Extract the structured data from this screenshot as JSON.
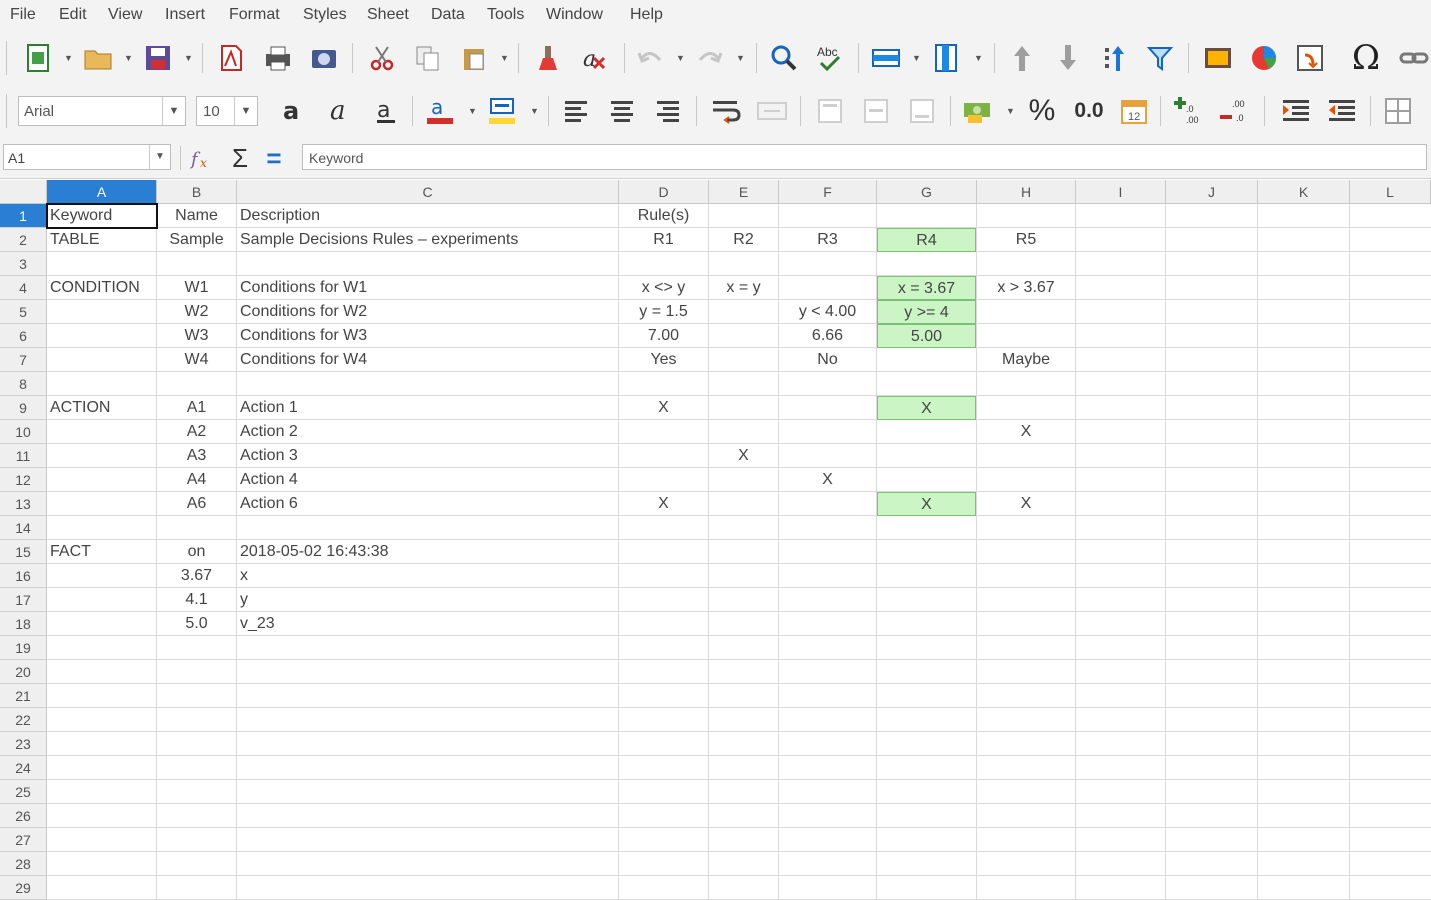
{
  "menu": [
    "File",
    "Edit",
    "View",
    "Insert",
    "Format",
    "Styles",
    "Sheet",
    "Data",
    "Tools",
    "Window",
    "Help"
  ],
  "toolbar": {
    "font_name": "Arial",
    "font_size": "10",
    "percent_label": "%",
    "decimal_label": "0.0",
    "omega_label": "Ω",
    "sum_label": "Σ",
    "equals_label": "="
  },
  "formula_bar": {
    "name_box": "A1",
    "content": "Keyword"
  },
  "columns": [
    "A",
    "B",
    "C",
    "D",
    "E",
    "F",
    "G",
    "H",
    "I",
    "J",
    "K",
    "L"
  ],
  "selected_column": "A",
  "selected_row": "1",
  "rows": [
    "1",
    "2",
    "3",
    "4",
    "5",
    "6",
    "7",
    "8",
    "9",
    "10",
    "11",
    "12",
    "13",
    "14",
    "15",
    "16",
    "17",
    "18",
    "19",
    "20",
    "21",
    "22",
    "23",
    "24",
    "25",
    "26",
    "27",
    "28",
    "29"
  ],
  "cells": [
    {
      "ref": "A1",
      "text": "Keyword"
    },
    {
      "ref": "B1",
      "text": "Name"
    },
    {
      "ref": "C1",
      "text": "Description"
    },
    {
      "ref": "D1",
      "text": "Rule(s)"
    },
    {
      "ref": "A2",
      "text": "TABLE"
    },
    {
      "ref": "B2",
      "text": "Sample"
    },
    {
      "ref": "C2",
      "text": "Sample Decisions Rules – experiments"
    },
    {
      "ref": "D2",
      "text": "R1"
    },
    {
      "ref": "E2",
      "text": "R2"
    },
    {
      "ref": "F2",
      "text": "R3"
    },
    {
      "ref": "G2",
      "text": "R4",
      "highlight": true
    },
    {
      "ref": "H2",
      "text": "R5"
    },
    {
      "ref": "A4",
      "text": "CONDITION"
    },
    {
      "ref": "B4",
      "text": "W1"
    },
    {
      "ref": "C4",
      "text": "Conditions for W1"
    },
    {
      "ref": "D4",
      "text": "x <> y"
    },
    {
      "ref": "E4",
      "text": "x = y"
    },
    {
      "ref": "G4",
      "text": "x = 3.67",
      "highlight": true
    },
    {
      "ref": "H4",
      "text": "x > 3.67"
    },
    {
      "ref": "B5",
      "text": "W2"
    },
    {
      "ref": "C5",
      "text": "Conditions for W2"
    },
    {
      "ref": "D5",
      "text": "y = 1.5"
    },
    {
      "ref": "F5",
      "text": "y < 4.00"
    },
    {
      "ref": "G5",
      "text": "y >= 4",
      "highlight": true
    },
    {
      "ref": "B6",
      "text": "W3"
    },
    {
      "ref": "C6",
      "text": "Conditions for W3"
    },
    {
      "ref": "D6",
      "text": "7.00"
    },
    {
      "ref": "F6",
      "text": "6.66"
    },
    {
      "ref": "G6",
      "text": "5.00",
      "highlight": true
    },
    {
      "ref": "B7",
      "text": "W4"
    },
    {
      "ref": "C7",
      "text": "Conditions for W4"
    },
    {
      "ref": "D7",
      "text": "Yes"
    },
    {
      "ref": "F7",
      "text": "No"
    },
    {
      "ref": "H7",
      "text": "Maybe"
    },
    {
      "ref": "A9",
      "text": "ACTION"
    },
    {
      "ref": "B9",
      "text": "A1"
    },
    {
      "ref": "C9",
      "text": "Action 1"
    },
    {
      "ref": "D9",
      "text": "X"
    },
    {
      "ref": "G9",
      "text": "X",
      "highlight": true
    },
    {
      "ref": "B10",
      "text": "A2"
    },
    {
      "ref": "C10",
      "text": "Action 2"
    },
    {
      "ref": "H10",
      "text": "X"
    },
    {
      "ref": "B11",
      "text": "A3"
    },
    {
      "ref": "C11",
      "text": "Action 3"
    },
    {
      "ref": "E11",
      "text": "X"
    },
    {
      "ref": "B12",
      "text": "A4"
    },
    {
      "ref": "C12",
      "text": "Action 4"
    },
    {
      "ref": "F12",
      "text": "X"
    },
    {
      "ref": "B13",
      "text": "A6"
    },
    {
      "ref": "C13",
      "text": "Action 6"
    },
    {
      "ref": "D13",
      "text": "X"
    },
    {
      "ref": "G13",
      "text": "X",
      "highlight": true
    },
    {
      "ref": "H13",
      "text": "X"
    },
    {
      "ref": "A15",
      "text": "FACT"
    },
    {
      "ref": "B15",
      "text": "on"
    },
    {
      "ref": "C15",
      "text": "2018-05-02 16:43:38"
    },
    {
      "ref": "B16",
      "text": "3.67"
    },
    {
      "ref": "C16",
      "text": "x"
    },
    {
      "ref": "B17",
      "text": "4.1"
    },
    {
      "ref": "C17",
      "text": "y"
    },
    {
      "ref": "B18",
      "text": "5.0"
    },
    {
      "ref": "C18",
      "text": "v_23"
    }
  ],
  "colors": {
    "selection": "#2a7fd4",
    "highlight_fill": "#ccf5c6",
    "highlight_border": "#7fbf78"
  }
}
